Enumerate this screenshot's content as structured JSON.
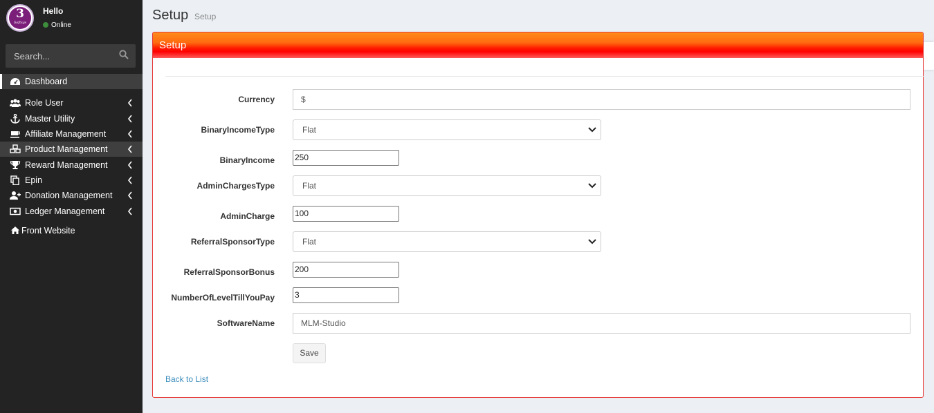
{
  "sidebar": {
    "user": {
      "name": "Hello",
      "status": "Online",
      "logo_letter": "3",
      "logo_word": "Softsys"
    },
    "search": {
      "placeholder": "Search..."
    },
    "items": [
      {
        "label": "Dashboard",
        "icon": "dashboard-icon"
      },
      {
        "label": "Role User",
        "icon": "users-icon"
      },
      {
        "label": "Master Utility",
        "icon": "anchor-icon"
      },
      {
        "label": "Affiliate Management",
        "icon": "coffee-icon"
      },
      {
        "label": "Product Management",
        "icon": "cubes-icon"
      },
      {
        "label": "Reward Management",
        "icon": "trophy-icon"
      },
      {
        "label": "Epin",
        "icon": "copy-icon"
      },
      {
        "label": "Donation Management",
        "icon": "user-plus-icon"
      },
      {
        "label": "Ledger Management",
        "icon": "money-icon"
      },
      {
        "label": "Front Website",
        "icon": "home-icon"
      }
    ]
  },
  "header": {
    "title": "Setup",
    "subtitle": "Setup"
  },
  "panel": {
    "title": "Setup"
  },
  "form": {
    "currency": {
      "label": "Currency",
      "value": "$"
    },
    "binary_income_type": {
      "label": "BinaryIncomeType",
      "value": "Flat"
    },
    "binary_income": {
      "label": "BinaryIncome",
      "value": "250"
    },
    "admin_charges_type": {
      "label": "AdminChargesType",
      "value": "Flat"
    },
    "admin_charge": {
      "label": "AdminCharge",
      "value": "100"
    },
    "referral_sponsor_type": {
      "label": "ReferralSponsorType",
      "value": "Flat"
    },
    "referral_sponsor_bonus": {
      "label": "ReferralSponsorBonus",
      "value": "200"
    },
    "number_of_level": {
      "label": "NumberOfLevelTillYouPay",
      "value": "3"
    },
    "software_name": {
      "label": "SoftwareName",
      "value": "MLM-Studio"
    },
    "save_label": "Save",
    "back_label": "Back to List"
  },
  "colors": {
    "sidebar_bg": "#232323",
    "panel_border": "#e53935",
    "link": "#3c8dbc",
    "online": "#3c8d3c"
  }
}
